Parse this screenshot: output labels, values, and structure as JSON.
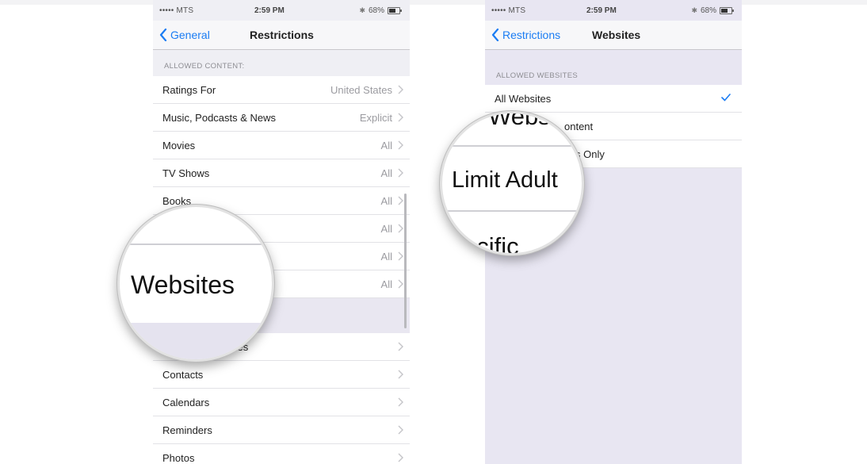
{
  "status_bar": {
    "carrier": "••••• MTS",
    "time": "2:59 PM",
    "battery": "68%"
  },
  "left_screen": {
    "back_label": "General",
    "title": "Restrictions",
    "section_header": "ALLOWED CONTENT:",
    "rows": [
      {
        "label": "Ratings For",
        "value": "United States"
      },
      {
        "label": "Music, Podcasts & News",
        "value": "Explicit"
      },
      {
        "label": "Movies",
        "value": "All"
      },
      {
        "label": "TV Shows",
        "value": "All"
      },
      {
        "label": "Books",
        "value": "All"
      },
      {
        "label": "",
        "value": "All"
      },
      {
        "label": "",
        "value": "All"
      },
      {
        "label": "",
        "value": "All"
      }
    ],
    "privacy_rows": [
      {
        "label": "ces"
      },
      {
        "label": "Contacts"
      },
      {
        "label": "Calendars"
      },
      {
        "label": "Reminders"
      },
      {
        "label": "Photos"
      }
    ],
    "magnifier_text": "Websites"
  },
  "right_screen": {
    "back_label": "Restrictions",
    "title": "Websites",
    "section_header": "ALLOWED WEBSITES",
    "rows": [
      {
        "label": "All Websites",
        "checked": true
      },
      {
        "label": "ontent"
      },
      {
        "label": "s Only"
      }
    ],
    "magnifier_top_text": "Webs",
    "magnifier_text": "Limit Adult",
    "magnifier_bottom_text": "ecific"
  },
  "colors": {
    "accent": "#1a7cf3",
    "background": "#efeff4",
    "secondary_text": "#9b9ba0"
  }
}
